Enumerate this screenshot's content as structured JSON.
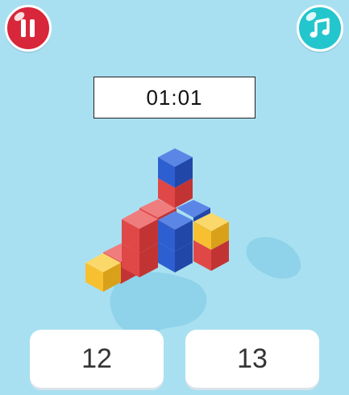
{
  "theme": {
    "background": "#a9e0f1",
    "splash": "#8fd3ea",
    "pause_color": "#d8263a",
    "music_color": "#23c6cc",
    "cube_colors": {
      "blue": "#2e5fd0",
      "red": "#e04848",
      "yellow": "#f6c030"
    }
  },
  "hud": {
    "pause_icon": "pause-icon",
    "music_icon": "music-note-icon",
    "timer": "01:01"
  },
  "puzzle": {
    "cube_count_colors": [
      "blue",
      "red",
      "yellow"
    ]
  },
  "answers": [
    {
      "label": "12"
    },
    {
      "label": "13"
    }
  ]
}
